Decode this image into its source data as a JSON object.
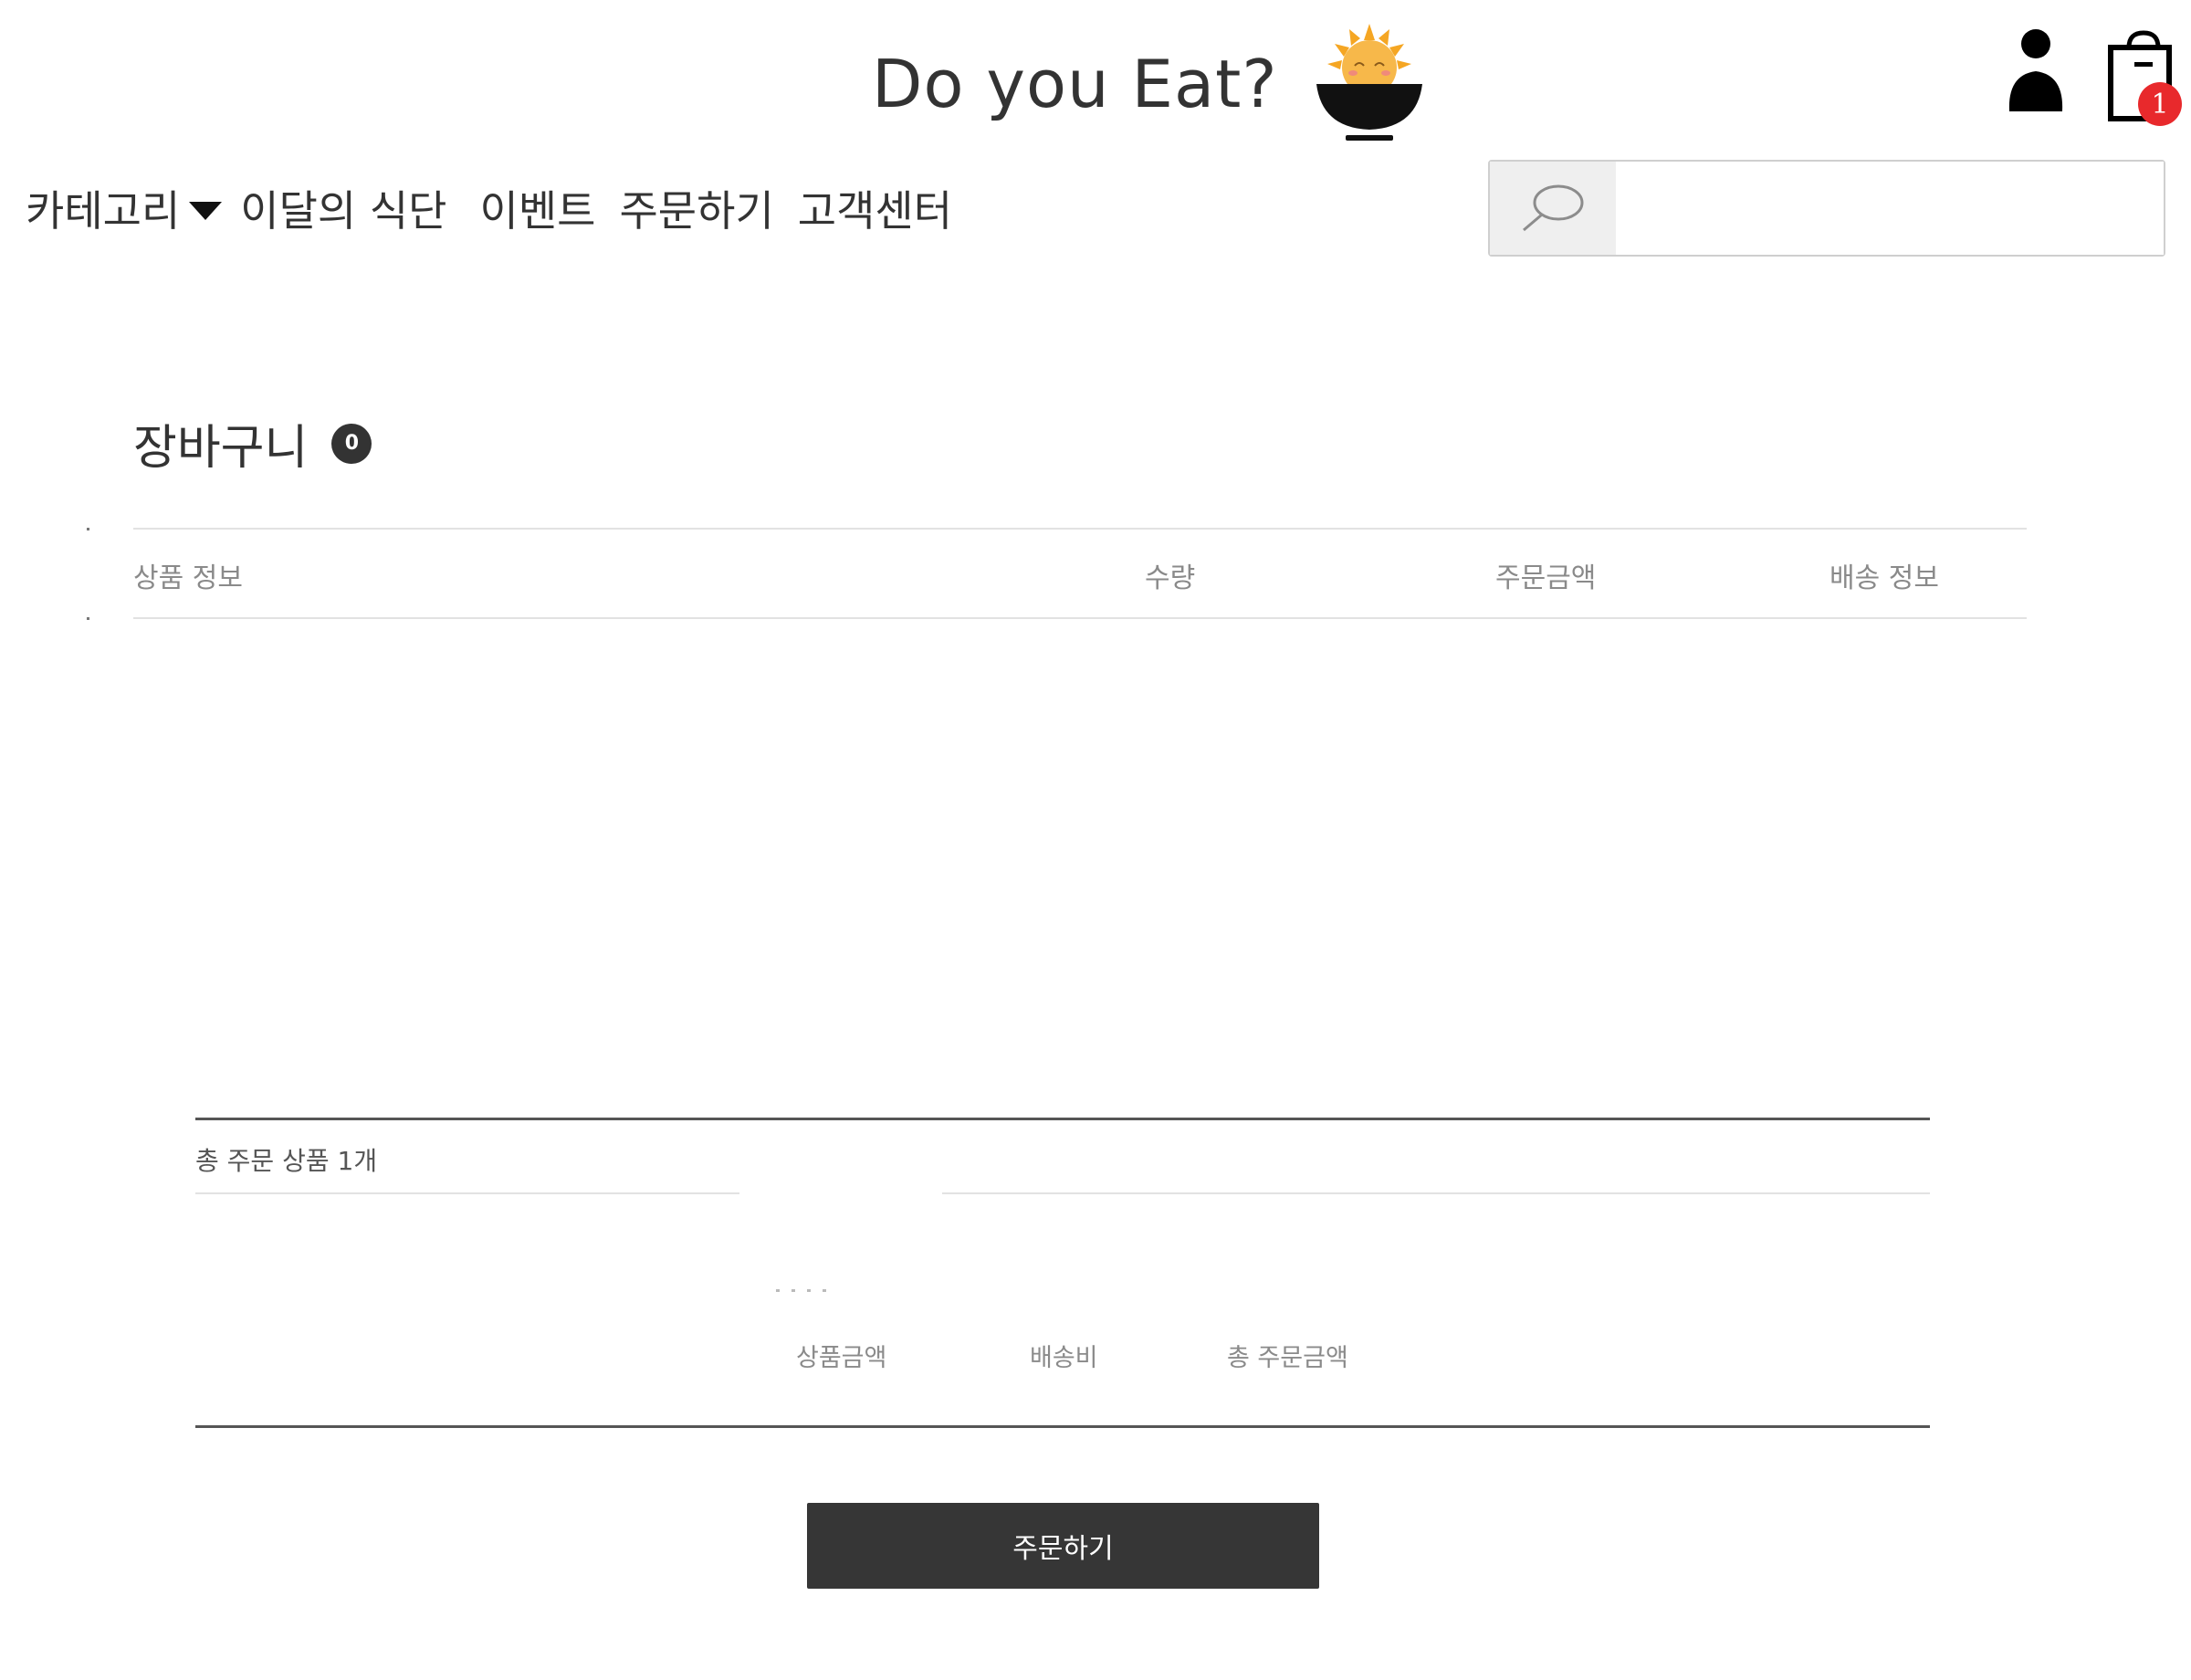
{
  "header": {
    "logo_text": "Do you Eat?",
    "cart_badge": "1",
    "icons": [
      "user-icon",
      "cart-bag-icon",
      "rice-bowl-logo-icon",
      "search-icon"
    ]
  },
  "nav": {
    "category": "카테고리",
    "items": [
      "이달의 식단",
      "이벤트",
      "주문하기",
      "고객센터"
    ]
  },
  "search": {
    "placeholder": "",
    "value": ""
  },
  "cart": {
    "title": "장바구니",
    "count": "0",
    "columns": [
      "상품 정보",
      "수량",
      "주문금액",
      "배송 정보"
    ]
  },
  "summary": {
    "total_items": "총 주문 상품 1개",
    "labels": [
      "상품금액",
      "배송비",
      "총 주문금액"
    ]
  },
  "actions": {
    "order_button": "주문하기"
  },
  "colors": {
    "badge": "#e8292c",
    "button": "#363636",
    "logo_sun": "#f5a623",
    "bowl": "#111111"
  }
}
